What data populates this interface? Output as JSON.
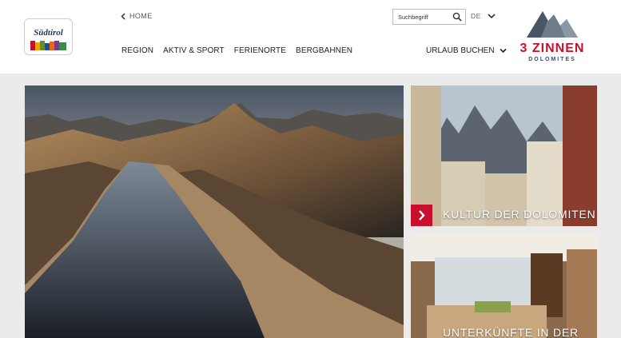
{
  "header": {
    "logo_text": "Südtirol",
    "home_label": "HOME",
    "nav": [
      "REGION",
      "AKTIV & SPORT",
      "FERIENORTE",
      "BERGBAHNEN"
    ],
    "search_placeholder": "Suchbegriff",
    "language": "DE",
    "booking_label": "URLAUB BUCHEN",
    "brand_title": "3 ZINNEN",
    "brand_subtitle": "DOLOMITES"
  },
  "tiles": [
    {
      "caption": "KULTUR DER DOLOMITEN"
    },
    {
      "caption": "UNTERKÜNFTE IN DER"
    }
  ],
  "colors": {
    "accent": "#c8102e",
    "brand_blue": "#2a4d8c",
    "background": "#ebebeb"
  }
}
